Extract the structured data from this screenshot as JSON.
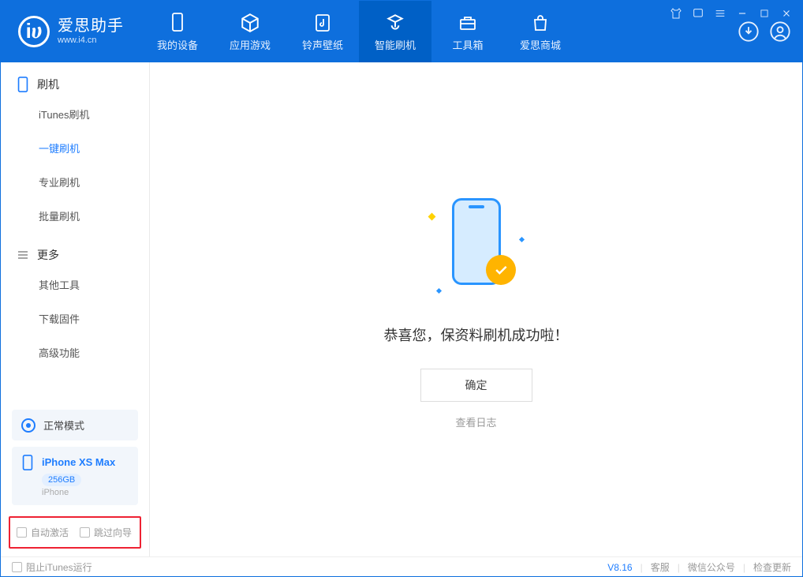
{
  "app": {
    "title": "爱思助手",
    "subtitle": "www.i4.cn"
  },
  "nav": {
    "items": [
      {
        "label": "我的设备",
        "icon": "device"
      },
      {
        "label": "应用游戏",
        "icon": "cube"
      },
      {
        "label": "铃声壁纸",
        "icon": "music"
      },
      {
        "label": "智能刷机",
        "icon": "refresh"
      },
      {
        "label": "工具箱",
        "icon": "toolbox"
      },
      {
        "label": "爱思商城",
        "icon": "bag"
      }
    ],
    "active": 3
  },
  "sidebar": {
    "group_flash": "刷机",
    "flash_items": [
      "iTunes刷机",
      "一键刷机",
      "专业刷机",
      "批量刷机"
    ],
    "flash_active": 1,
    "group_more": "更多",
    "more_items": [
      "其他工具",
      "下载固件",
      "高级功能"
    ],
    "mode_label": "正常模式",
    "device": {
      "name": "iPhone XS Max",
      "capacity": "256GB",
      "type": "iPhone"
    },
    "opt_auto_activate": "自动激活",
    "opt_skip_guide": "跳过向导"
  },
  "main": {
    "success_text": "恭喜您，保资料刷机成功啦！",
    "ok_button": "确定",
    "view_log": "查看日志"
  },
  "footer": {
    "block_itunes": "阻止iTunes运行",
    "version": "V8.16",
    "support": "客服",
    "wechat": "微信公众号",
    "check_update": "检查更新"
  }
}
